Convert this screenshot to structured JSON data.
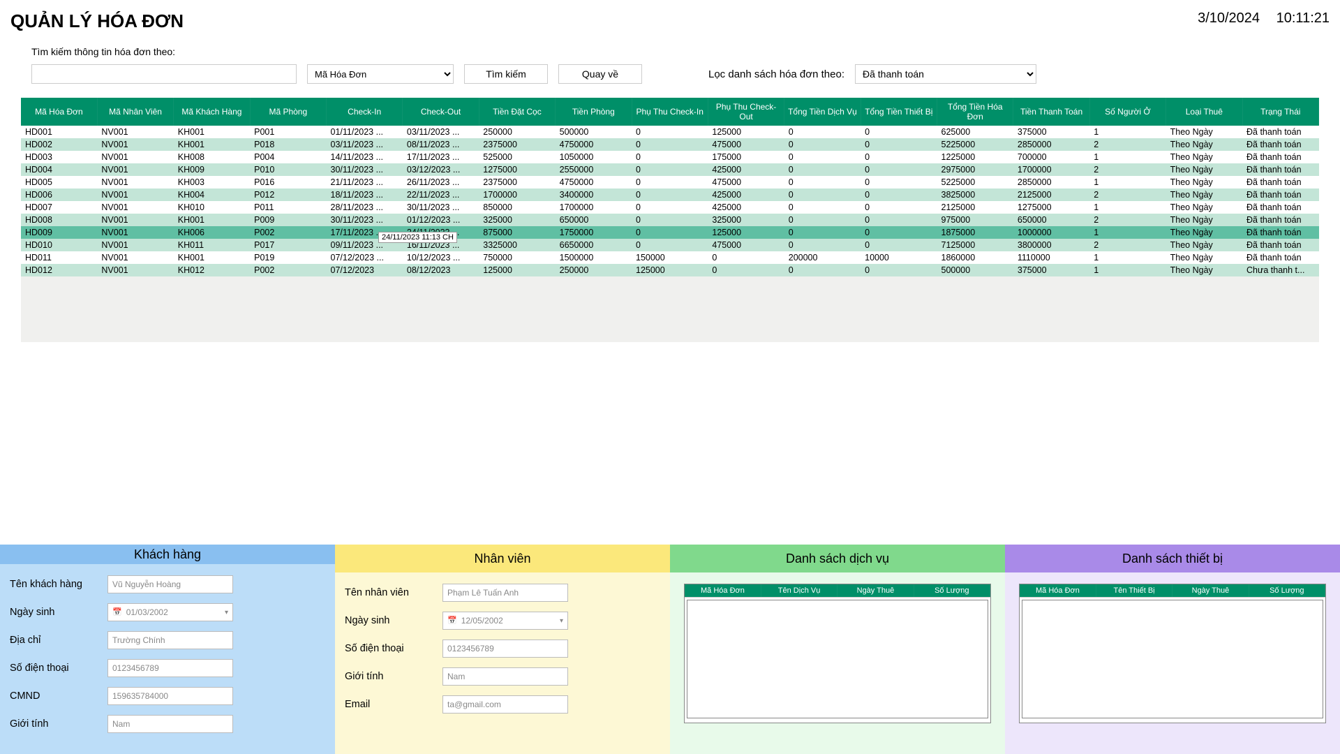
{
  "title": "QUẢN LÝ HÓA ĐƠN",
  "date": "3/10/2024",
  "time": "10:11:21",
  "search": {
    "label": "Tìm kiếm thông tin hóa đơn theo:",
    "field_option": "Mã Hóa Đơn",
    "btn_search": "Tìm kiếm",
    "btn_back": "Quay về"
  },
  "filter": {
    "label": "Lọc danh sách hóa đơn theo:",
    "option": "Đã thanh toán"
  },
  "table": {
    "headers": [
      "Mã Hóa Đơn",
      "Mã Nhân Viên",
      "Mã Khách Hàng",
      "Mã Phòng",
      "Check-In",
      "Check-Out",
      "Tiền Đặt Cọc",
      "Tiền Phòng",
      "Phụ Thu Check-In",
      "Phụ Thu Check-Out",
      "Tổng Tiền Dịch Vụ",
      "Tổng Tiền Thiết Bị",
      "Tổng Tiền Hóa Đơn",
      "Tiền Thanh Toán",
      "Số Người Ở",
      "Loại Thuê",
      "Trạng Thái"
    ],
    "rows": [
      [
        "HD001",
        "NV001",
        "KH001",
        "P001",
        "01/11/2023 ...",
        "03/11/2023 ...",
        "250000",
        "500000",
        "0",
        "125000",
        "0",
        "0",
        "625000",
        "375000",
        "1",
        "Theo Ngày",
        "Đã thanh toán"
      ],
      [
        "HD002",
        "NV001",
        "KH001",
        "P018",
        "03/11/2023 ...",
        "08/11/2023 ...",
        "2375000",
        "4750000",
        "0",
        "475000",
        "0",
        "0",
        "5225000",
        "2850000",
        "2",
        "Theo Ngày",
        "Đã thanh toán"
      ],
      [
        "HD003",
        "NV001",
        "KH008",
        "P004",
        "14/11/2023 ...",
        "17/11/2023 ...",
        "525000",
        "1050000",
        "0",
        "175000",
        "0",
        "0",
        "1225000",
        "700000",
        "1",
        "Theo Ngày",
        "Đã thanh toán"
      ],
      [
        "HD004",
        "NV001",
        "KH009",
        "P010",
        "30/11/2023 ...",
        "03/12/2023 ...",
        "1275000",
        "2550000",
        "0",
        "425000",
        "0",
        "0",
        "2975000",
        "1700000",
        "2",
        "Theo Ngày",
        "Đã thanh toán"
      ],
      [
        "HD005",
        "NV001",
        "KH003",
        "P016",
        "21/11/2023 ...",
        "26/11/2023 ...",
        "2375000",
        "4750000",
        "0",
        "475000",
        "0",
        "0",
        "5225000",
        "2850000",
        "1",
        "Theo Ngày",
        "Đã thanh toán"
      ],
      [
        "HD006",
        "NV001",
        "KH004",
        "P012",
        "18/11/2023 ...",
        "22/11/2023 ...",
        "1700000",
        "3400000",
        "0",
        "425000",
        "0",
        "0",
        "3825000",
        "2125000",
        "2",
        "Theo Ngày",
        "Đã thanh toán"
      ],
      [
        "HD007",
        "NV001",
        "KH010",
        "P011",
        "28/11/2023 ...",
        "30/11/2023 ...",
        "850000",
        "1700000",
        "0",
        "425000",
        "0",
        "0",
        "2125000",
        "1275000",
        "1",
        "Theo Ngày",
        "Đã thanh toán"
      ],
      [
        "HD008",
        "NV001",
        "KH001",
        "P009",
        "30/11/2023 ...",
        "01/12/2023 ...",
        "325000",
        "650000",
        "0",
        "325000",
        "0",
        "0",
        "975000",
        "650000",
        "2",
        "Theo Ngày",
        "Đã thanh toán"
      ],
      [
        "HD009",
        "NV001",
        "KH006",
        "P002",
        "17/11/2023 ...",
        "24/11/2023 ...",
        "875000",
        "1750000",
        "0",
        "125000",
        "0",
        "0",
        "1875000",
        "1000000",
        "1",
        "Theo Ngày",
        "Đã thanh toán"
      ],
      [
        "HD010",
        "NV001",
        "KH011",
        "P017",
        "09/11/2023 ...",
        "16/11/2023 ...",
        "3325000",
        "6650000",
        "0",
        "475000",
        "0",
        "0",
        "7125000",
        "3800000",
        "2",
        "Theo Ngày",
        "Đã thanh toán"
      ],
      [
        "HD011",
        "NV001",
        "KH001",
        "P019",
        "07/12/2023 ...",
        "10/12/2023 ...",
        "750000",
        "1500000",
        "150000",
        "0",
        "200000",
        "10000",
        "1860000",
        "1110000",
        "1",
        "Theo Ngày",
        "Đã thanh toán"
      ],
      [
        "HD012",
        "NV001",
        "KH012",
        "P002",
        "07/12/2023",
        "08/12/2023",
        "125000",
        "250000",
        "125000",
        "0",
        "0",
        "0",
        "500000",
        "375000",
        "1",
        "Theo Ngày",
        "Chưa thanh t..."
      ]
    ],
    "selected_index": 8,
    "tooltip": "24/11/2023 11:13 CH"
  },
  "panels": {
    "kh": {
      "title": "Khách hàng",
      "fields": [
        {
          "label": "Tên khách hàng",
          "value": "Vũ Nguyễn Hoàng",
          "type": "text"
        },
        {
          "label": "Ngày sinh",
          "value": "01/03/2002",
          "type": "date"
        },
        {
          "label": "Địa chỉ",
          "value": "Trường Chính",
          "type": "text"
        },
        {
          "label": "Số điện thoại",
          "value": "0123456789",
          "type": "text"
        },
        {
          "label": "CMND",
          "value": "159635784000",
          "type": "text"
        },
        {
          "label": "Giới tính",
          "value": "Nam",
          "type": "text"
        }
      ]
    },
    "nv": {
      "title": "Nhân viên",
      "fields": [
        {
          "label": "Tên nhân viên",
          "value": "Phạm Lê Tuấn Anh",
          "type": "text"
        },
        {
          "label": "Ngày sinh",
          "value": "12/05/2002",
          "type": "date"
        },
        {
          "label": "Số điện thoại",
          "value": "0123456789",
          "type": "text"
        },
        {
          "label": "Giới tính",
          "value": "Nam",
          "type": "text"
        },
        {
          "label": "Email",
          "value": "ta@gmail.com",
          "type": "text"
        }
      ]
    },
    "dv": {
      "title": "Danh sách dịch vụ",
      "headers": [
        "Mã Hóa Đơn",
        "Tên Dịch Vụ",
        "Ngày Thuê",
        "Số Lượng"
      ]
    },
    "tb": {
      "title": "Danh sách thiết bị",
      "headers": [
        "Mã Hóa Đơn",
        "Tên Thiết Bị",
        "Ngày Thuê",
        "Số Lượng"
      ]
    }
  }
}
